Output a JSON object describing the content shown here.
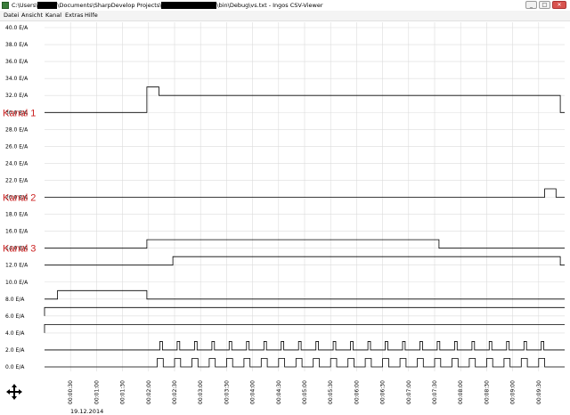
{
  "window": {
    "title_prefix": "C:\\Users\\",
    "title_part2": "\\Documents\\SharpDevelop Projects\\",
    "title_part3": "\\bin\\Debug\\vs.txt - Ingos CSV-Viewer",
    "buttons": {
      "minimize": "_",
      "maximize": "□",
      "close": "✕"
    }
  },
  "menu": [
    "Datei",
    "Ansicht",
    "Kanal",
    "Extras",
    "Hilfe"
  ],
  "date_label": "19.12.2014",
  "icons": {
    "app": "app-icon",
    "nav": "move-arrows-icon"
  },
  "colors": {
    "trace": "#000000",
    "grid": "#dcdcdc",
    "channel_label": "#cc2222"
  },
  "chart_data": {
    "type": "line",
    "y_ticks": [
      "0.0 E/A",
      "2.0 E/A",
      "4.0 E/A",
      "6.0 E/A",
      "8.0 E/A",
      "10.0 E/A",
      "12.0 E/A",
      "14.0 E/A",
      "16.0 E/A",
      "18.0 E/A",
      "20.0 E/A",
      "22.0 E/A",
      "24.0 E/A",
      "26.0 E/A",
      "28.0 E/A",
      "30.0 E/A",
      "32.0 E/A",
      "34.0 E/A",
      "36.0 E/A",
      "38.0 E/A",
      "40.0 E/A"
    ],
    "ylim": [
      0,
      40
    ],
    "x_ticks": [
      "00:00:30",
      "00:01:00",
      "00:01:30",
      "00:02:00",
      "00:02:30",
      "00:03:00",
      "00:03:30",
      "00:04:00",
      "00:04:30",
      "00:05:00",
      "00:05:30",
      "00:06:00",
      "00:06:30",
      "00:07:00",
      "00:07:30",
      "00:08:00",
      "00:08:30",
      "00:09:00",
      "00:09:30"
    ],
    "xlim_s": [
      0,
      600
    ],
    "grid": true,
    "channel_labels": [
      {
        "text": "Kanal 1",
        "y": 30
      },
      {
        "text": "Kanal 2",
        "y": 20
      },
      {
        "text": "Kanal 3",
        "y": 14
      }
    ],
    "series": [
      {
        "points": [
          [
            0,
            30
          ],
          [
            118,
            30
          ],
          [
            118,
            33
          ],
          [
            132,
            33
          ],
          [
            132,
            32
          ],
          [
            595,
            32
          ],
          [
            595,
            30
          ],
          [
            600,
            30
          ]
        ]
      },
      {
        "points": [
          [
            0,
            20
          ],
          [
            577,
            20
          ],
          [
            577,
            21
          ],
          [
            590,
            21
          ],
          [
            590,
            20
          ],
          [
            600,
            20
          ]
        ]
      },
      {
        "points": [
          [
            0,
            14
          ],
          [
            118,
            14
          ],
          [
            118,
            15
          ],
          [
            455,
            15
          ],
          [
            455,
            14
          ],
          [
            600,
            14
          ]
        ]
      },
      {
        "points": [
          [
            0,
            12
          ],
          [
            148,
            12
          ],
          [
            148,
            13
          ],
          [
            595,
            13
          ],
          [
            595,
            12
          ],
          [
            600,
            12
          ]
        ]
      },
      {
        "points": [
          [
            0,
            8
          ],
          [
            15,
            8
          ],
          [
            15,
            9
          ],
          [
            118,
            9
          ],
          [
            118,
            8
          ],
          [
            600,
            8
          ]
        ]
      },
      {
        "points": [
          [
            0,
            6
          ],
          [
            0,
            7
          ],
          [
            600,
            7
          ]
        ]
      },
      {
        "points": [
          [
            0,
            4
          ],
          [
            0,
            5
          ],
          [
            600,
            5
          ]
        ]
      }
    ],
    "pulses": [
      {
        "base": 2,
        "high": 3,
        "start": 133,
        "period": 20,
        "width": 3,
        "count": 23
      },
      {
        "base": 0,
        "high": 1,
        "start": 130,
        "period": 20,
        "width": 7,
        "count": 23
      }
    ]
  }
}
